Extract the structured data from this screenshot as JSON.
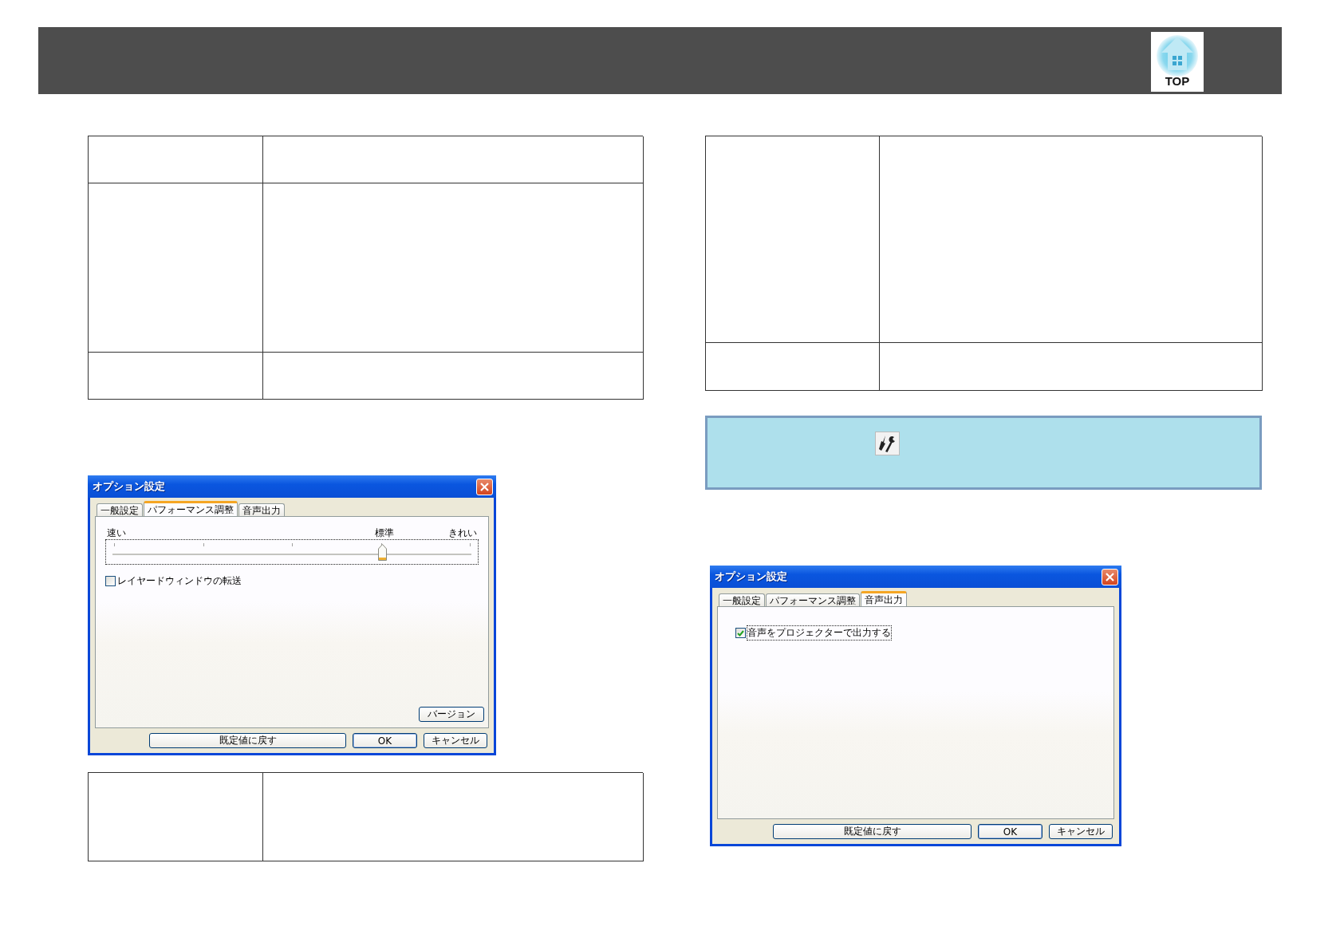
{
  "header": {
    "top_link": {
      "label": "TOP"
    }
  },
  "dialogs": [
    {
      "title": "オプション設定",
      "tabs": [
        {
          "label": "一般設定",
          "selected": false
        },
        {
          "label": "パフォーマンス調整",
          "selected": true
        },
        {
          "label": "音声出力",
          "selected": false
        }
      ],
      "controls": [
        {
          "kind": "slider",
          "labels": [
            "速い",
            "標準",
            "きれい"
          ],
          "level": 0.75,
          "focused": true
        },
        {
          "kind": "checkbox",
          "label": "レイヤードウィンドウの転送",
          "checked": false,
          "focused": false
        },
        {
          "kind": "version",
          "label": "バージョン"
        }
      ],
      "buttons": [
        "既定値に戻す",
        "OK",
        "キャンセル"
      ]
    },
    {
      "title": "オプション設定",
      "tabs": [
        {
          "label": "一般設定",
          "selected": false
        },
        {
          "label": "パフォーマンス調整",
          "selected": false
        },
        {
          "label": "音声出力",
          "selected": true
        }
      ],
      "controls": [
        {
          "kind": "checkbox",
          "label": "音声をプロジェクターで出力する",
          "checked": true,
          "focused": true
        }
      ],
      "buttons": [
        "既定値に戻す",
        "OK",
        "キャンセル"
      ]
    }
  ]
}
